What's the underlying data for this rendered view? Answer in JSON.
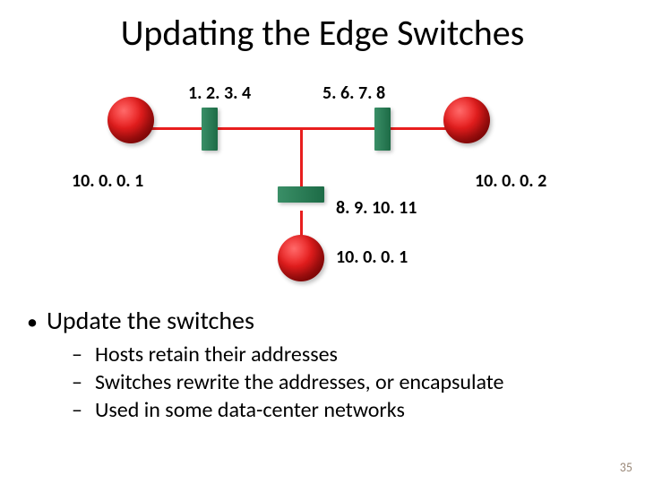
{
  "title": "Updating the Edge Switches",
  "diagram": {
    "switch_left_label": "1. 2. 3. 4",
    "switch_right_label": "5. 6. 7. 8",
    "switch_mid_label": "8. 9. 10. 11",
    "host_left_label": "10. 0. 0. 1",
    "host_right_label": "10. 0. 0. 2",
    "host_mid_label": "10. 0. 0. 1"
  },
  "bullets": {
    "main": "Update the switches",
    "subs": [
      "Hosts retain their addresses",
      "Switches rewrite the addresses, or encapsulate",
      "Used in some data-center networks"
    ]
  },
  "page_number": "35"
}
